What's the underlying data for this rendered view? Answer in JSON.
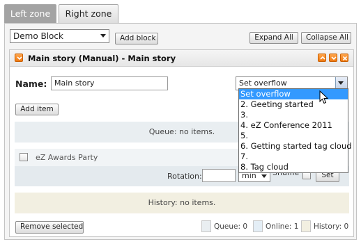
{
  "tabs": [
    {
      "label": "Left zone",
      "active": true
    },
    {
      "label": "Right zone",
      "active": false
    }
  ],
  "toolbar": {
    "block_select_value": "Demo Block",
    "add_block_label": "Add block",
    "expand_all_label": "Expand All",
    "collapse_all_label": "Collapse All"
  },
  "block": {
    "title": "Main story (Manual) - Main story",
    "name_label": "Name:",
    "name_value": "Main story",
    "overflow_select_value": "Set overflow",
    "add_item_label": "Add item",
    "queue_text": "Queue: no items.",
    "item": {
      "title": "eZ Awards Party",
      "rotation_label": "Rotation:",
      "rotation_value": "",
      "rotation_unit": "min",
      "shuffle_label": "Shuffle",
      "set_label": "Set"
    },
    "history_text": "History: no items.",
    "remove_selected_label": "Remove selected",
    "counts": {
      "queue": "Queue: 0",
      "online": "Online: 1",
      "history": "History: 0"
    }
  },
  "overflow_options": [
    "Set overflow",
    "2. Geeting started",
    "3.",
    "4. eZ Conference 2011",
    "5.",
    "6. Getting started tag cloud",
    "7.",
    "8. Tag cloud"
  ],
  "colors": {
    "accent_orange": "#f07a10",
    "highlight_blue": "#3399ff",
    "queue_color": "#e9eef1",
    "online_color": "#e4eef6",
    "history_color": "#f2efe1"
  }
}
